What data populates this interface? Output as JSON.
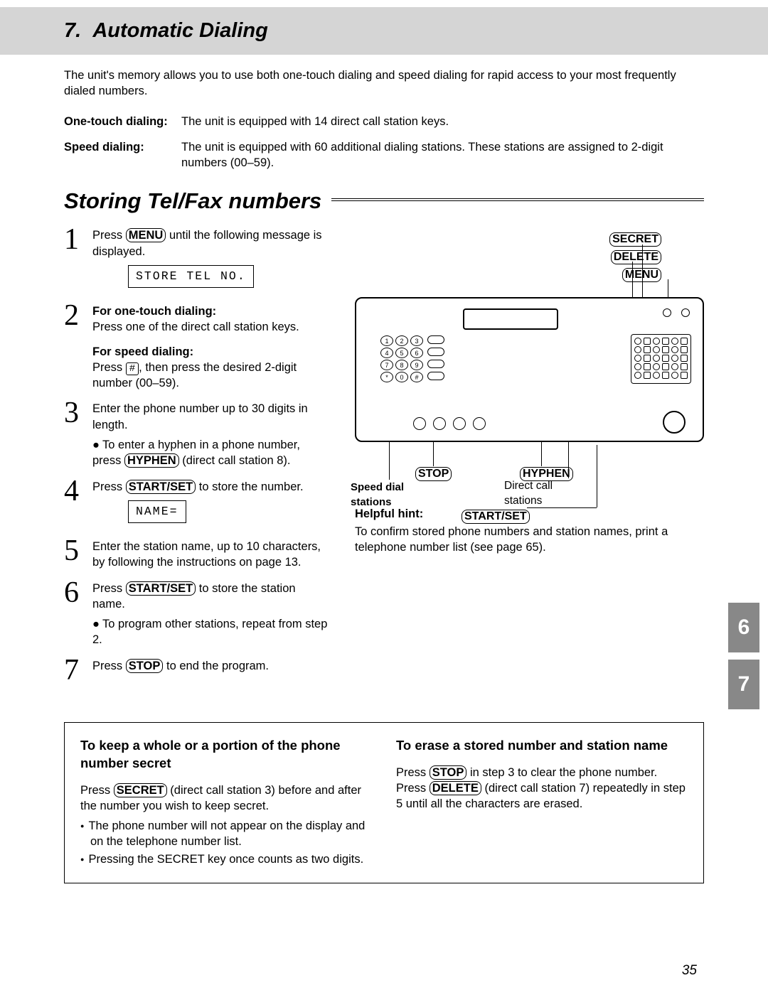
{
  "header": {
    "chapter": "7.",
    "title": "Automatic Dialing"
  },
  "intro": "The unit's memory allows you to use both one-touch dialing and speed dialing for rapid access to your most frequently dialed numbers.",
  "definitions": [
    {
      "term": "One-touch dialing:",
      "desc": "The unit is equipped with 14 direct call station keys."
    },
    {
      "term": "Speed dialing:",
      "desc": "The unit is equipped with 60 additional dialing stations. These stations are assigned to 2-digit numbers (00–59)."
    }
  ],
  "section_title": "Storing Tel/Fax numbers",
  "steps": {
    "s1_a": "Press ",
    "s1_btn": "MENU",
    "s1_b": " until the following message is displayed.",
    "lcd1": "STORE TEL NO.",
    "s2_h1": "For one-touch dialing:",
    "s2_t1": "Press one of the direct call station keys.",
    "s2_h2": "For speed dialing:",
    "s2_t2a": "Press ",
    "s2_key": "#",
    "s2_t2b": ", then press the desired 2-digit number (00–59).",
    "s3": "Enter the phone number up to 30 digits in length.",
    "s3_note_a": "To enter a hyphen in a phone number, press ",
    "s3_note_btn": "HYPHEN",
    "s3_note_b": " (direct call station 8).",
    "s4_a": "Press ",
    "s4_btn": "START/SET",
    "s4_b": " to store the number.",
    "lcd2": "NAME=",
    "s5": "Enter the station name, up to 10 characters, by following the instructions on page 13.",
    "s6_a": "Press ",
    "s6_btn": "START/SET",
    "s6_b": " to store the station name.",
    "s6_note": "To program other stations, repeat from step 2.",
    "s7_a": "Press ",
    "s7_btn": "STOP",
    "s7_b": " to end the program."
  },
  "diagram_labels": {
    "secret": "SECRET",
    "delete": "DELETE",
    "menu": "MENU",
    "stop": "STOP",
    "hyphen": "HYPHEN",
    "speed_dial_1": "Speed dial",
    "speed_dial_2": "stations",
    "direct_1": "Direct call",
    "direct_2": "stations",
    "startset": "START/SET"
  },
  "keypad": [
    "1",
    "2",
    "3",
    "4",
    "5",
    "6",
    "7",
    "8",
    "9",
    "*",
    "0",
    "#"
  ],
  "hint": {
    "title": "Helpful hint:",
    "text": "To confirm stored phone numbers and station names, print a telephone number list (see page 65)."
  },
  "side_tabs": [
    "6",
    "7"
  ],
  "box": {
    "left": {
      "title": "To keep a whole or a portion of the phone number secret",
      "p_a": "Press ",
      "p_btn": "SECRET",
      "p_b": " (direct call station 3) before and after the number you wish to keep secret.",
      "bullets": [
        "The phone number will not appear on the display and on the telephone number list.",
        "Pressing the SECRET key once counts as two digits."
      ]
    },
    "right": {
      "title": "To erase a stored number and station name",
      "p1_a": "Press ",
      "p1_btn": "STOP",
      "p1_b": " in step 3 to clear the phone number.",
      "p2_a": "Press ",
      "p2_btn": "DELETE",
      "p2_b": " (direct call station 7) repeatedly in step 5 until all the characters are erased."
    }
  },
  "page_number": "35"
}
